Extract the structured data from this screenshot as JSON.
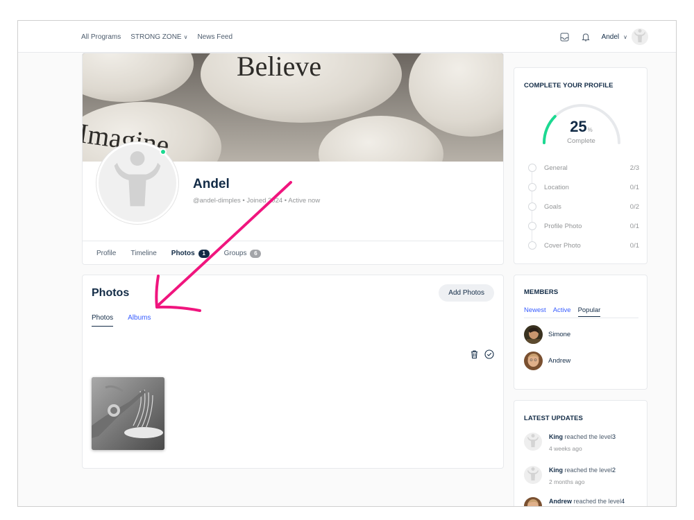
{
  "topbar": {
    "nav": [
      "All Programs",
      "STRONG ZONE",
      "News Feed"
    ],
    "nav_dropdown_index": 1,
    "user_name": "Andel"
  },
  "cover": {
    "words": [
      "Believe",
      "Imagine"
    ]
  },
  "profile": {
    "name": "Andel",
    "meta": "@andel-dimples • Joined      2024 • Active now",
    "tabs": [
      {
        "label": "Profile"
      },
      {
        "label": "Timeline"
      },
      {
        "label": "Photos",
        "count": "1"
      },
      {
        "label": "Groups",
        "count": "6"
      }
    ]
  },
  "photos": {
    "title": "Photos",
    "add_button": "Add Photos",
    "subtabs": [
      "Photos",
      "Albums"
    ],
    "tools": [
      "trash-icon",
      "check-circle-icon"
    ]
  },
  "complete_profile": {
    "title": "COMPLETE YOUR PROFILE",
    "value": "25",
    "unit": "%",
    "label": "Complete",
    "progress": 0.25,
    "items": [
      {
        "label": "General",
        "value": "2/3"
      },
      {
        "label": "Location",
        "value": "0/1"
      },
      {
        "label": "Goals",
        "value": "0/2"
      },
      {
        "label": "Profile Photo",
        "value": "0/1"
      },
      {
        "label": "Cover Photo",
        "value": "0/1"
      }
    ]
  },
  "members": {
    "title": "MEMBERS",
    "tabs": [
      "Newest",
      "Active",
      "Popular"
    ],
    "list": [
      "Simone",
      "Andrew"
    ]
  },
  "updates": {
    "title": "LATEST UPDATES",
    "items": [
      {
        "name": "King",
        "text": " reached the level",
        "level": "3",
        "time": "4 weeks ago"
      },
      {
        "name": "King",
        "text": " reached the level",
        "level": "2",
        "time": "2 months ago"
      },
      {
        "name": "Andrew",
        "text": " reached the level",
        "level": "4",
        "time": ""
      }
    ]
  },
  "colors": {
    "accent": "#385dff",
    "online": "#1cd991",
    "gauge": "#1cd991",
    "annotation_arrow": "#f0157e",
    "dark_badge": "#122b46",
    "grey_badge": "#a3a5a9"
  }
}
